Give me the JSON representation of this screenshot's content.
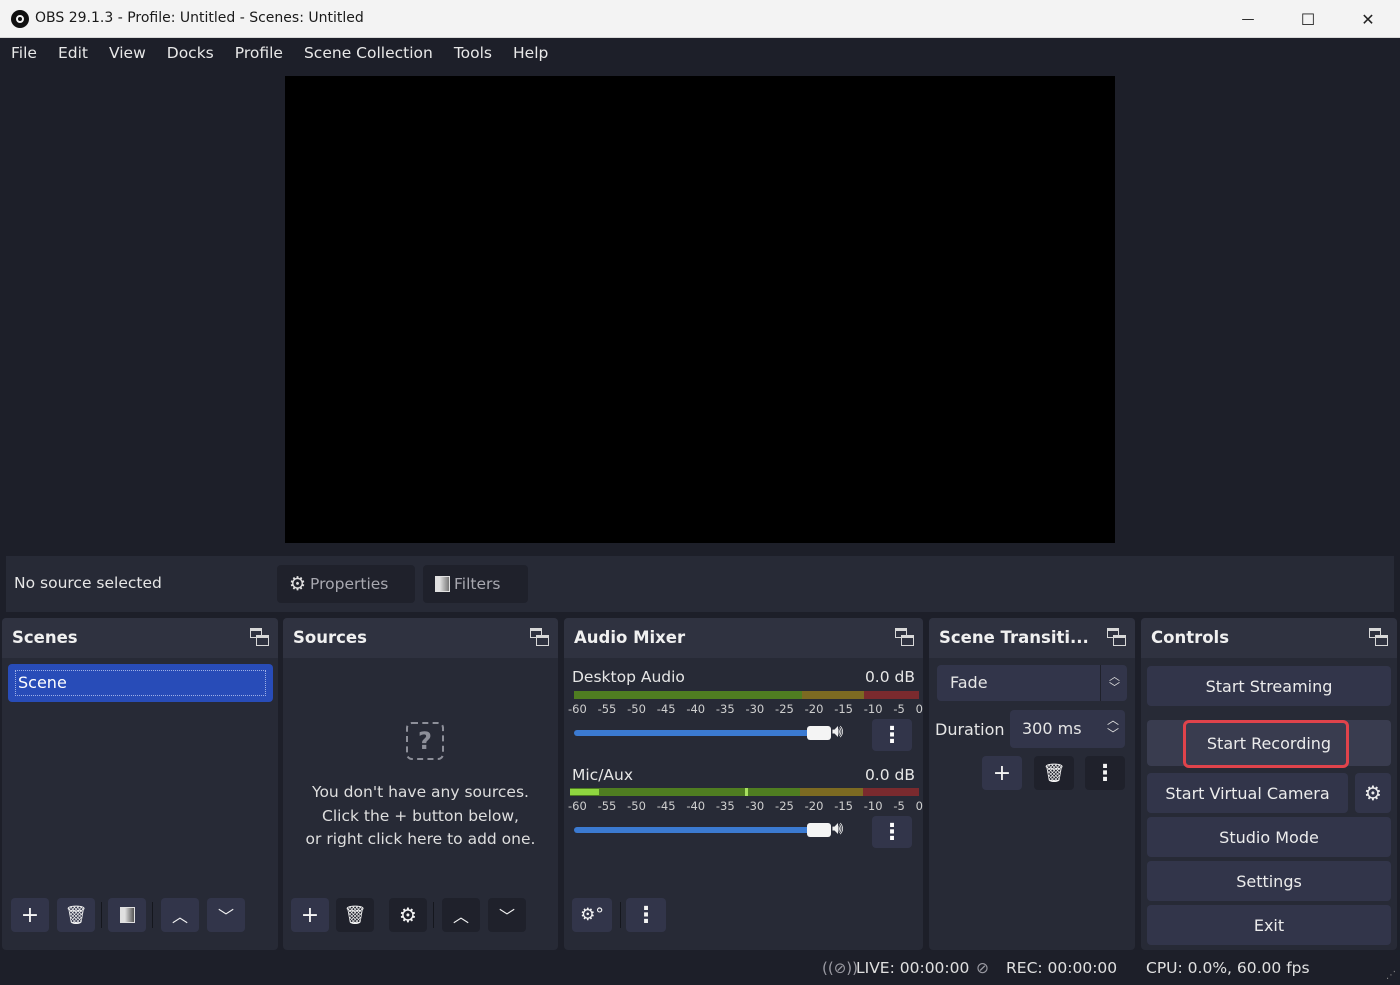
{
  "window": {
    "title": "OBS 29.1.3 - Profile: Untitled - Scenes: Untitled",
    "controls": {
      "minimize": "—",
      "maximize": "☐",
      "close": "✕"
    }
  },
  "menu": [
    "File",
    "Edit",
    "View",
    "Docks",
    "Profile",
    "Scene Collection",
    "Tools",
    "Help"
  ],
  "context_bar": {
    "status": "No source selected",
    "properties_label": "Properties",
    "filters_label": "Filters"
  },
  "docks": {
    "scenes": {
      "title": "Scenes",
      "items": [
        "Scene"
      ],
      "selected": "Scene"
    },
    "sources": {
      "title": "Sources",
      "empty_lines": [
        "You don't have any sources.",
        "Click the + button below,",
        "or right click here to add one."
      ]
    },
    "audio_mixer": {
      "title": "Audio Mixer",
      "channels": [
        {
          "name": "Desktop Audio",
          "db": "0.0 dB",
          "volume_pct": 100,
          "level_db": -60,
          "peak_db": -60
        },
        {
          "name": "Mic/Aux",
          "db": "0.0 dB",
          "volume_pct": 100,
          "level_db": -55,
          "peak_db": -30
        }
      ],
      "scale": [
        "-60",
        "-55",
        "-50",
        "-45",
        "-40",
        "-35",
        "-30",
        "-25",
        "-20",
        "-15",
        "-10",
        "-5",
        "0"
      ]
    },
    "transitions": {
      "title": "Scene Transiti...",
      "selected": "Fade",
      "duration_label": "Duration",
      "duration_value": "300 ms"
    },
    "controls": {
      "title": "Controls",
      "buttons": [
        "Start Streaming",
        "Start Recording",
        "Start Virtual Camera",
        "Studio Mode",
        "Settings",
        "Exit"
      ],
      "highlighted": "Start Recording"
    }
  },
  "status_bar": {
    "live": "LIVE: 00:00:00",
    "rec": "REC: 00:00:00",
    "cpu": "CPU: 0.0%, 60.00 fps"
  },
  "colors": {
    "accent": "#284cb8",
    "highlight_box": "#e0434b",
    "meter_green": "#4f7d21",
    "meter_yellow": "#7c6a22",
    "meter_red": "#7a2a2e",
    "volume_slider": "#3b7ad1"
  }
}
